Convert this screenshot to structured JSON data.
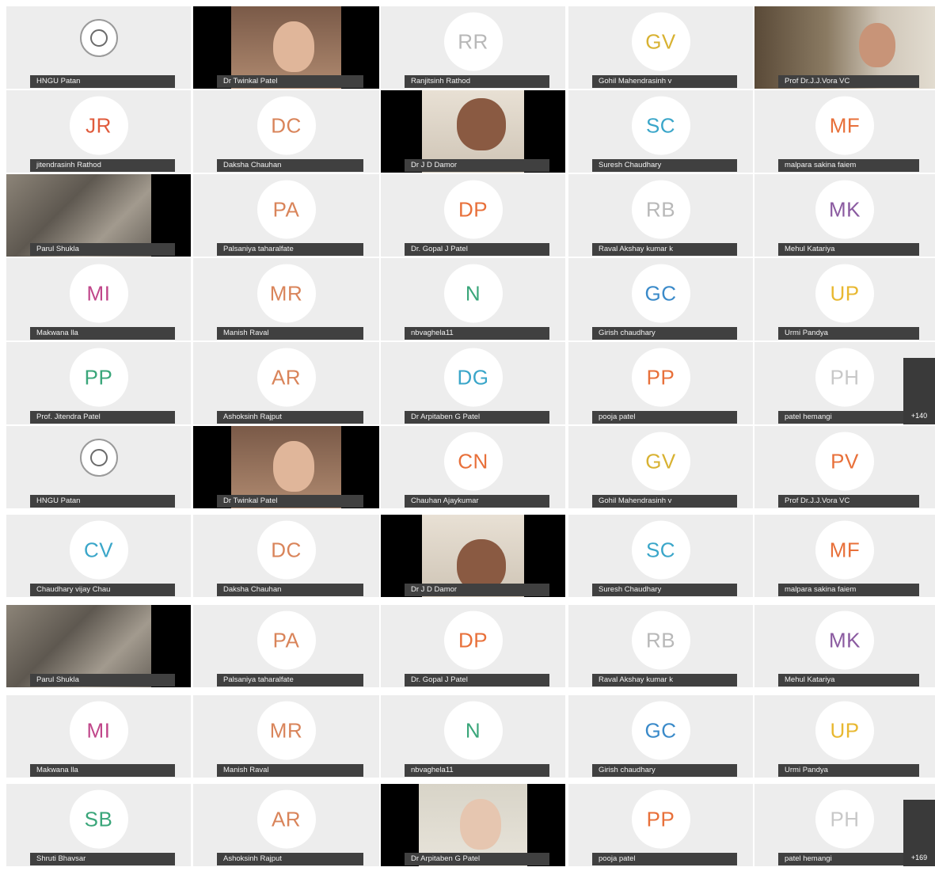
{
  "grid": {
    "rows": [
      [
        {
          "type": "logo",
          "icon": "university-logo",
          "name": "HNGU Patan"
        },
        {
          "type": "video",
          "variant": "woman",
          "name": "Dr Twinkal Patel"
        },
        {
          "type": "initials",
          "initials": "RR",
          "color": "#b8b8b8",
          "name": "Ranjitsinh Rathod"
        },
        {
          "type": "initials",
          "initials": "GV",
          "color": "#d8b232",
          "name": "Gohil Mahendrasinh v"
        },
        {
          "type": "video",
          "variant": "office",
          "name": "Prof Dr.J.J.Vora VC"
        }
      ],
      [
        {
          "type": "initials",
          "initials": "JR",
          "color": "#e05b3c",
          "name": "jitendrasinh Rathod"
        },
        {
          "type": "initials",
          "initials": "DC",
          "color": "#d9845a",
          "name": "Daksha Chauhan"
        },
        {
          "type": "video",
          "variant": "man",
          "name": "Dr J D Damor"
        },
        {
          "type": "initials",
          "initials": "SC",
          "color": "#3aa6c9",
          "name": "Suresh Chaudhary"
        },
        {
          "type": "initials",
          "initials": "MF",
          "color": "#e8703a",
          "name": "malpara sakina faiem"
        }
      ],
      [
        {
          "type": "video",
          "variant": "blur",
          "name": "Parul Shukla"
        },
        {
          "type": "initials",
          "initials": "PA",
          "color": "#d9845a",
          "name": "Palsaniya taharalfate"
        },
        {
          "type": "initials",
          "initials": "DP",
          "color": "#e8703a",
          "name": "Dr. Gopal J Patel"
        },
        {
          "type": "initials",
          "initials": "RB",
          "color": "#b8b8b8",
          "name": "Raval Akshay kumar k"
        },
        {
          "type": "initials",
          "initials": "MK",
          "color": "#8a5aa0",
          "name": "Mehul Katariya"
        }
      ],
      [
        {
          "type": "initials",
          "initials": "MI",
          "color": "#c0468a",
          "name": "Makwana lla"
        },
        {
          "type": "initials",
          "initials": "MR",
          "color": "#d9845a",
          "name": "Manish Raval"
        },
        {
          "type": "initials",
          "initials": "N",
          "color": "#3aa67a",
          "name": "nbvaghela11"
        },
        {
          "type": "initials",
          "initials": "GC",
          "color": "#3a8ac9",
          "name": "Girish chaudhary"
        },
        {
          "type": "initials",
          "initials": "UP",
          "color": "#e8b830",
          "name": "Urmi Pandya"
        }
      ],
      [
        {
          "type": "initials",
          "initials": "PP",
          "color": "#3aa67a",
          "name": "Prof. Jitendra Patel"
        },
        {
          "type": "initials",
          "initials": "AR",
          "color": "#d9845a",
          "name": "Ashoksinh Rajput"
        },
        {
          "type": "initials",
          "initials": "DG",
          "color": "#3aa6c9",
          "name": "Dr Arpitaben G Patel"
        },
        {
          "type": "initials",
          "initials": "PP",
          "color": "#e8703a",
          "name": "pooja patel"
        },
        {
          "type": "initials",
          "initials": "PH",
          "color": "#c8c8c8",
          "name": "patel hemangi",
          "more": "+140"
        }
      ],
      [
        {
          "type": "logo",
          "icon": "university-logo",
          "name": "HNGU Patan"
        },
        {
          "type": "video",
          "variant": "woman",
          "name": "Dr Twinkal Patel"
        },
        {
          "type": "initials",
          "initials": "CN",
          "color": "#e8703a",
          "name": "Chauhan Ajaykumar"
        },
        {
          "type": "initials",
          "initials": "GV",
          "color": "#d8b232",
          "name": "Gohil Mahendrasinh v"
        },
        {
          "type": "initials",
          "initials": "PV",
          "color": "#e8703a",
          "name": "Prof Dr.J.J.Vora VC"
        }
      ],
      [
        {
          "type": "initials",
          "initials": "CV",
          "color": "#3aa6c9",
          "name": "Chaudhary vijay Chau"
        },
        {
          "type": "initials",
          "initials": "DC",
          "color": "#d9845a",
          "name": "Daksha Chauhan"
        },
        {
          "type": "video",
          "variant": "man2",
          "name": "Dr J D Damor"
        },
        {
          "type": "initials",
          "initials": "SC",
          "color": "#3aa6c9",
          "name": "Suresh Chaudhary"
        },
        {
          "type": "initials",
          "initials": "MF",
          "color": "#e8703a",
          "name": "malpara sakina faiem"
        }
      ],
      [
        {
          "type": "video",
          "variant": "blur",
          "name": "Parul Shukla"
        },
        {
          "type": "initials",
          "initials": "PA",
          "color": "#d9845a",
          "name": "Palsaniya taharalfate"
        },
        {
          "type": "initials",
          "initials": "DP",
          "color": "#e8703a",
          "name": "Dr. Gopal J Patel"
        },
        {
          "type": "initials",
          "initials": "RB",
          "color": "#b8b8b8",
          "name": "Raval Akshay kumar k"
        },
        {
          "type": "initials",
          "initials": "MK",
          "color": "#8a5aa0",
          "name": "Mehul Katariya"
        }
      ],
      [
        {
          "type": "initials",
          "initials": "MI",
          "color": "#c0468a",
          "name": "Makwana lla"
        },
        {
          "type": "initials",
          "initials": "MR",
          "color": "#d9845a",
          "name": "Manish Raval"
        },
        {
          "type": "initials",
          "initials": "N",
          "color": "#3aa67a",
          "name": "nbvaghela11"
        },
        {
          "type": "initials",
          "initials": "GC",
          "color": "#3a8ac9",
          "name": "Girish chaudhary"
        },
        {
          "type": "initials",
          "initials": "UP",
          "color": "#e8b830",
          "name": "Urmi Pandya"
        }
      ],
      [
        {
          "type": "initials",
          "initials": "SB",
          "color": "#3aa67a",
          "name": "Shruti Bhavsar"
        },
        {
          "type": "initials",
          "initials": "AR",
          "color": "#d9845a",
          "name": "Ashoksinh Rajput"
        },
        {
          "type": "video",
          "variant": "woman2",
          "name": "Dr Arpitaben G Patel"
        },
        {
          "type": "initials",
          "initials": "PP",
          "color": "#e8703a",
          "name": "pooja patel"
        },
        {
          "type": "initials",
          "initials": "PH",
          "color": "#c8c8c8",
          "name": "patel hemangi",
          "more": "+169"
        }
      ]
    ]
  }
}
